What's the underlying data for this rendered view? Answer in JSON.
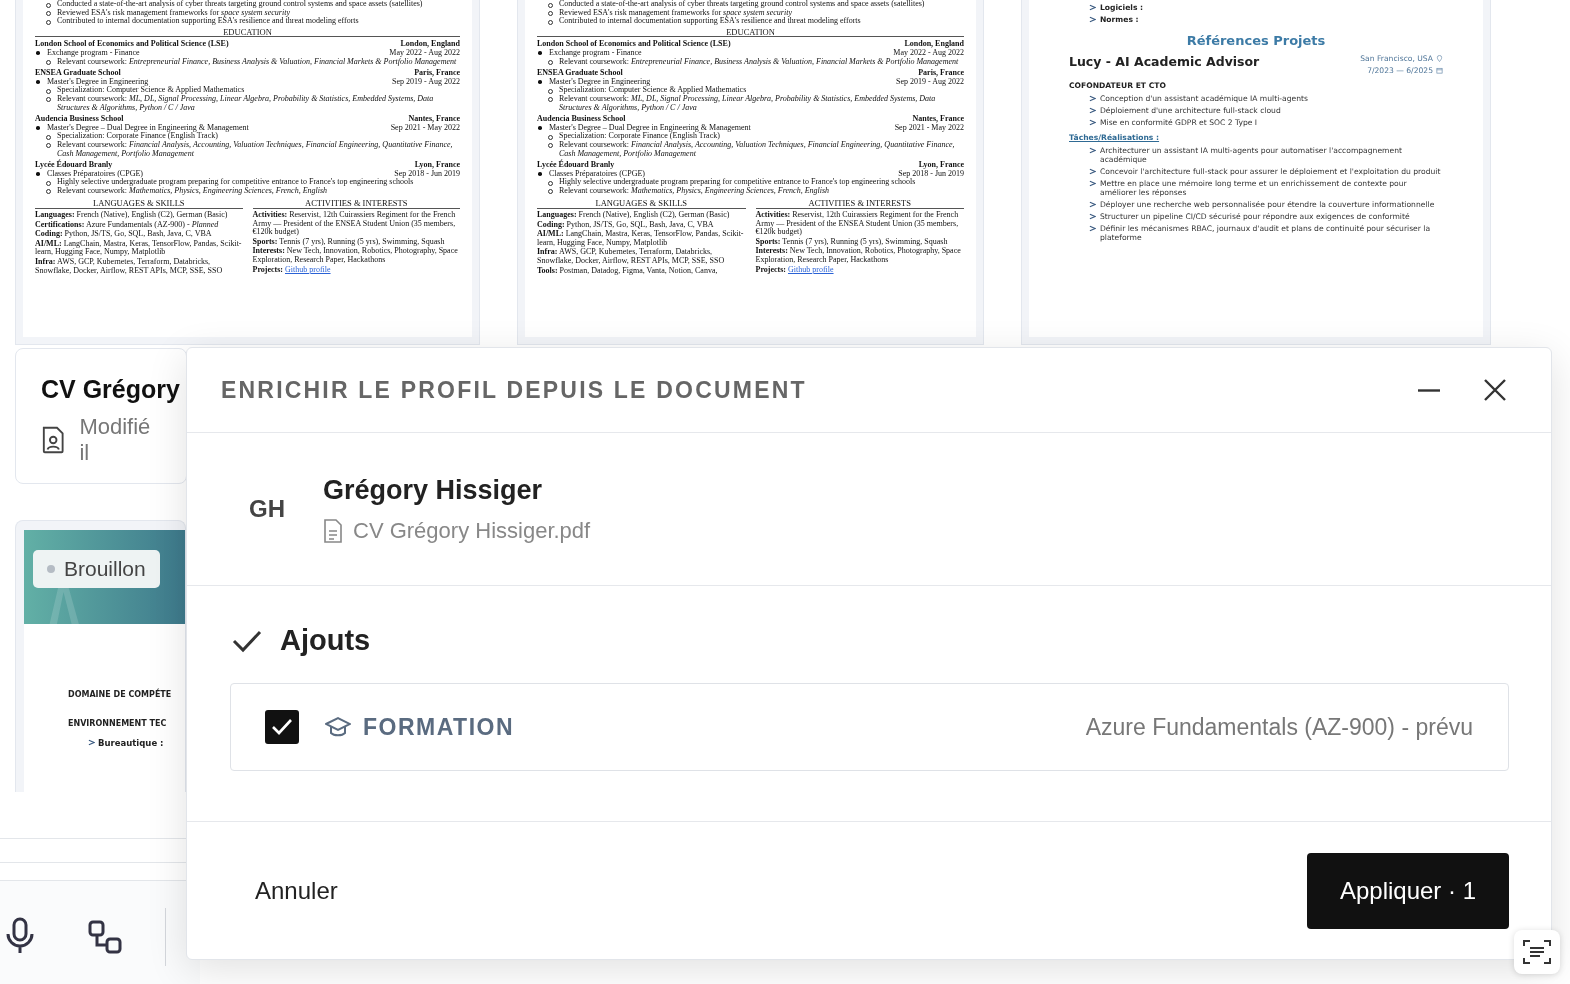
{
  "documents": [
    {
      "kind": "cv",
      "lines": [
        {
          "kind": "sub",
          "text": "Conducted a state-of-the-art analysis of cyber threats targeting ground control systems and space assets (satellites)"
        },
        {
          "kind": "sub",
          "text": "Reviewed ESA's risk management frameworks for *space system security*"
        },
        {
          "kind": "sub",
          "text": "Contributed to internal documentation supporting ESA's resilience and threat modeling efforts"
        },
        {
          "kind": "section",
          "text": "EDUCATION"
        },
        {
          "kind": "entry",
          "title": "London School of Economics and Political Science (LSE)",
          "place": "London, England"
        },
        {
          "kind": "item",
          "text": "Exchange program - Finance",
          "date": "May 2022 - Aug 2022"
        },
        {
          "kind": "sub",
          "text": "Relevant coursework: *Entrepreneurial Finance, Business Analysis & Valuation, Financial Markets & Portfolio Management*"
        },
        {
          "kind": "entry",
          "title": "ENSEA Graduate School",
          "place": "Paris, France"
        },
        {
          "kind": "item",
          "text": "Master's Degree in Engineering",
          "date": "Sep 2019 - Aug 2022"
        },
        {
          "kind": "sub",
          "text": "Specialization: Computer Science & Applied Mathematics"
        },
        {
          "kind": "sub",
          "text": "Relevant coursework: *ML, DL, Signal Processing, Linear Algebra, Probability & Statistics, Embedded Systems, Data Structures & Algorithms, Python / C / Java*"
        },
        {
          "kind": "entry",
          "title": "Audencia Business School",
          "place": "Nantes, France"
        },
        {
          "kind": "item",
          "text": "Master's Degree – Dual Degree in Engineering & Management",
          "date": "Sep 2021 - May 2022"
        },
        {
          "kind": "sub",
          "text": "Specialization: Corporate Finance (English Track)"
        },
        {
          "kind": "sub",
          "text": "Relevant coursework: *Financial Analysis, Accounting, Valuation Techniques, Financial Engineering, Quantitative Finance, Cash Management, Portfolio Management*"
        },
        {
          "kind": "entry",
          "title": "Lycée Édouard Branly",
          "place": "Lyon, France"
        },
        {
          "kind": "item",
          "text": "Classes Préparatoires (CPGE)",
          "date": "Sep 2018 - Jun 2019"
        },
        {
          "kind": "sub",
          "text": "Highly selective undergraduate program preparing for competitive entrance to France's top engineering schools"
        },
        {
          "kind": "sub",
          "text": "Relevant coursework: *Mathematics, Physics, Engineering Sciences, French, English*"
        },
        {
          "kind": "columns",
          "columns": [
            {
              "heading": "LANGUAGES & SKILLS",
              "items": [
                {
                  "text": "**Languages:** French (Native), English (C2), German (Basic)"
                },
                {
                  "text": "**Certifications:** Azure Fundamentals (AZ-900) - *Planned*"
                },
                {
                  "text": "**Coding:** Python, JS/TS, Go, SQL, Bash, Java, C, VBA"
                },
                {
                  "text": "**AI/ML:** LangChain, Mastra, Keras, TensorFlow, Pandas, Scikit-learn, Hugging Face, Numpy, Matplotlib"
                },
                {
                  "text": "**Infra:** AWS, GCP, Kubernetes, Terraform, Databricks, Snowflake, Docker, Airflow, REST APIs, MCP, SSE, SSO"
                }
              ]
            },
            {
              "heading": "ACTIVITIES & INTERESTS",
              "items": [
                {
                  "text": "**Activities:** Reservist, 12th Cuirassiers Regiment for the French Army — President of the ENSEA Student Union (35 members, €120k budget)"
                },
                {
                  "text": "**Sports:** Tennis (7 yrs), Running (5 yrs), Swimming, Squash"
                },
                {
                  "text": "**Interests:** New Tech, Innovation, Robotics, Photography, Space Exploration, Research Paper, Hackathons"
                },
                {
                  "text": "**Projects:**",
                  "link": "Github profile"
                }
              ]
            }
          ]
        }
      ]
    },
    {
      "kind": "cv",
      "lines": [
        {
          "kind": "sub",
          "text": "Conducted a state-of-the-art analysis of cyber threats targeting ground control systems and space assets (satellites)"
        },
        {
          "kind": "sub",
          "text": "Reviewed ESA's risk management frameworks for *space system security*"
        },
        {
          "kind": "sub",
          "text": "Contributed to internal documentation supporting ESA's resilience and threat modeling efforts"
        },
        {
          "kind": "section",
          "text": "EDUCATION"
        },
        {
          "kind": "entry",
          "title": "London School of Economics and Political Science (LSE)",
          "place": "London, England"
        },
        {
          "kind": "item",
          "text": "Exchange program - Finance",
          "date": "May 2022 - Aug 2022"
        },
        {
          "kind": "sub",
          "text": "Relevant coursework: *Entrepreneurial Finance, Business Analysis & Valuation, Financial Markets & Portfolio Management*"
        },
        {
          "kind": "entry",
          "title": "ENSEA Graduate School",
          "place": "Paris, France"
        },
        {
          "kind": "item",
          "text": "Master's Degree in Engineering",
          "date": "Sep 2019 - Aug 2022"
        },
        {
          "kind": "sub",
          "text": "Specialization: Computer Science & Applied Mathematics"
        },
        {
          "kind": "sub",
          "text": "Relevant coursework: *ML, DL, Signal Processing, Linear Algebra, Probability & Statistics, Embedded Systems, Data Structures & Algorithms, Python / C / Java*"
        },
        {
          "kind": "entry",
          "title": "Audencia Business School",
          "place": "Nantes, France"
        },
        {
          "kind": "item",
          "text": "Master's Degree – Dual Degree in Engineering & Management",
          "date": "Sep 2021 - May 2022"
        },
        {
          "kind": "sub",
          "text": "Specialization: Corporate Finance (English Track)"
        },
        {
          "kind": "sub",
          "text": "Relevant coursework: *Financial Analysis, Accounting, Valuation Techniques, Financial Engineering, Quantitative Finance, Cash Management, Portfolio Management*"
        },
        {
          "kind": "entry",
          "title": "Lycée Édouard Branly",
          "place": "Lyon, France"
        },
        {
          "kind": "item",
          "text": "Classes Préparatoires (CPGE)",
          "date": "Sep 2018 - Jun 2019"
        },
        {
          "kind": "sub",
          "text": "Highly selective undergraduate program preparing for competitive entrance to France's top engineering schools"
        },
        {
          "kind": "sub",
          "text": "Relevant coursework: *Mathematics, Physics, Engineering Sciences, French, English*"
        },
        {
          "kind": "columns",
          "columns": [
            {
              "heading": "LANGUAGES & SKILLS",
              "items": [
                {
                  "text": "**Languages:** French (Native), English (C2), German (Basic)"
                },
                {
                  "text": "**Coding:** Python, JS/TS, Go, SQL, Bash, Java, C, VBA"
                },
                {
                  "text": "**AI/ML:** LangChain, Mastra, Keras, TensorFlow, Pandas, Scikit-learn, Hugging Face, Numpy, Matplotlib"
                },
                {
                  "text": "**Infra:** AWS, GCP, Kubernetes, Terraform, Databricks, Snowflake, Docker, Airflow, REST APIs, MCP, SSE, SSO"
                },
                {
                  "text": "**Tools:** Postman, Datadog, Figma, Vanta, Notion, Canva,"
                }
              ]
            },
            {
              "heading": "ACTIVITIES & INTERESTS",
              "items": [
                {
                  "text": "**Activities:** Reservist, 12th Cuirassiers Regiment for the French Army — President of the ENSEA Student Union (35 members, €120k budget)"
                },
                {
                  "text": "**Sports:** Tennis (7 yrs), Running (5 yrs), Swimming, Squash"
                },
                {
                  "text": "**Interests:** New Tech, Innovation, Robotics, Photography, Space Exploration, Research Paper, Hackathons"
                },
                {
                  "text": "**Projects:**",
                  "link": "Github profile"
                }
              ]
            }
          ]
        }
      ]
    },
    {
      "kind": "fr",
      "lines": [
        {
          "kind": "chevron_label",
          "text": "Logiciels :"
        },
        {
          "kind": "chevron_label",
          "text": "Normes :"
        },
        {
          "kind": "title",
          "text": "Références Projets"
        },
        {
          "kind": "project",
          "title": "Lucy - AI Academic Advisor",
          "place": "San Francisco, USA",
          "dates": "7/2023 — 6/2025"
        },
        {
          "kind": "role",
          "text": "COFONDATEUR ET CTO"
        },
        {
          "kind": "chevron",
          "text": "Conception d'un assistant académique IA multi-agents"
        },
        {
          "kind": "chevron",
          "text": "Déploiement d'une architecture full-stack cloud"
        },
        {
          "kind": "chevron",
          "text": "Mise en conformité GDPR et SOC 2 Type I"
        },
        {
          "kind": "tasks",
          "text": "Tâches/Réalisations :"
        },
        {
          "kind": "chevron",
          "text": "Architecturer un assistant IA multi-agents pour automatiser l'accompagnement académique"
        },
        {
          "kind": "chevron",
          "text": "Concevoir l'architecture full-stack pour assurer le déploiement et l'exploitation du produit"
        },
        {
          "kind": "chevron",
          "text": "Mettre en place une mémoire long terme et un enrichissement de contexte pour améliorer les réponses"
        },
        {
          "kind": "chevron",
          "text": "Déployer une recherche web personnalisée pour étendre la couverture informationnelle"
        },
        {
          "kind": "chevron",
          "text": "Structurer un pipeline CI/CD sécurisé pour répondre aux exigences de conformité"
        },
        {
          "kind": "chevron",
          "text": "Définir les mécanismes RBAC, journaux d'audit et plans de continuité pour sécuriser la plateforme"
        }
      ]
    }
  ],
  "file_card": {
    "title": "CV Grégory",
    "subtitle": "Modifié il"
  },
  "draft_card": {
    "badge": "Brouillon",
    "lines": [
      {
        "kind": "role",
        "text": "DOMAINE DE COMPÉTE"
      },
      {
        "kind": "role",
        "text": "ENVIRONNEMENT TEC"
      },
      {
        "kind": "chevron_label",
        "text": "Bureautique :"
      }
    ]
  },
  "dialog": {
    "title": "ENRICHIR LE PROFIL DEPUIS LE DOCUMENT",
    "profile": {
      "initials": "GH",
      "name": "Grégory Hissiger",
      "file": "CV Grégory Hissiger.pdf"
    },
    "additions": {
      "title": "Ajouts",
      "items": [
        {
          "category": "FORMATION",
          "value": "Azure Fundamentals (AZ-900) - prévu",
          "checked": true
        }
      ]
    },
    "cancel": "Annuler",
    "apply": "Appliquer · 1"
  }
}
